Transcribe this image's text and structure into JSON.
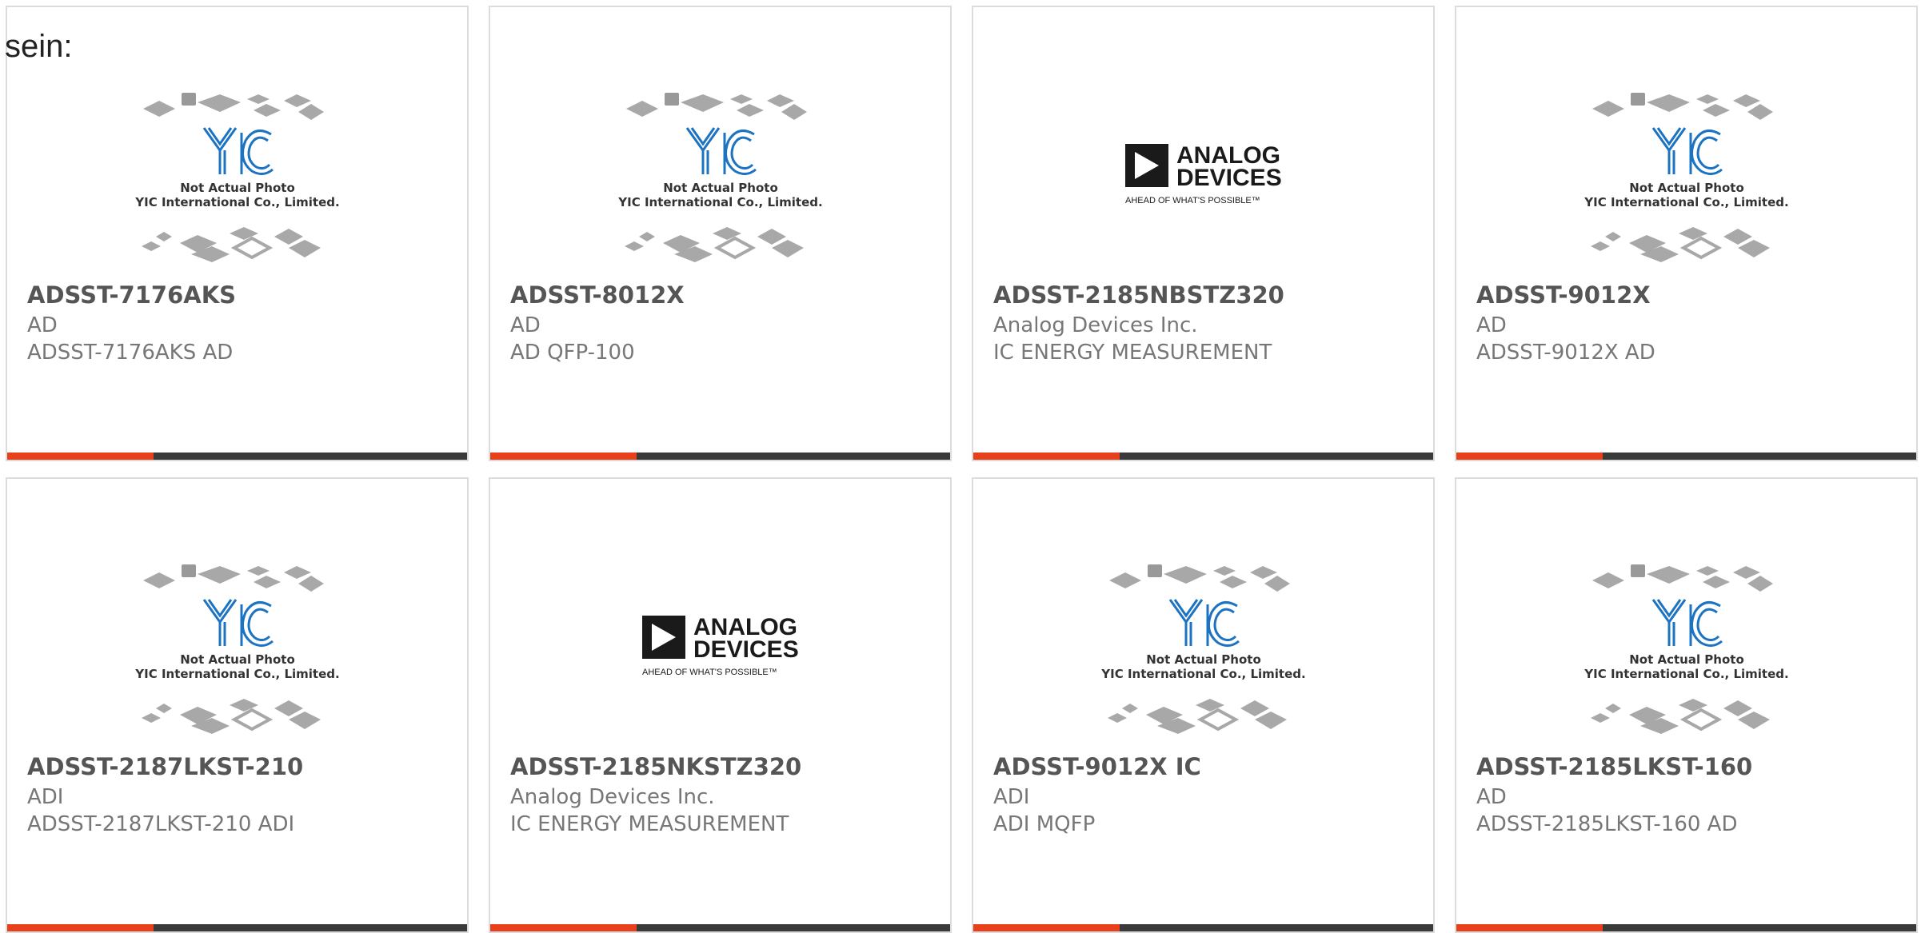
{
  "intro_text": "sein:",
  "colors": {
    "accent": "#e8401b",
    "bar": "#3a3a3a",
    "yic_blue": "#1b73c2"
  },
  "placeholder": {
    "caption_line1": "Not Actual Photo",
    "caption_line2": "YIC International Co., Limited.",
    "logo_text": "YIC"
  },
  "adi_logo": {
    "line1": "ANALOG",
    "line2": "DEVICES",
    "tagline": "AHEAD OF WHAT'S POSSIBLE™"
  },
  "products": [
    {
      "part_number": "ADSST-7176AKS",
      "manufacturer": "AD",
      "description": "ADSST-7176AKS AD",
      "image": "yic-placeholder"
    },
    {
      "part_number": "ADSST-8012X",
      "manufacturer": "AD",
      "description": "AD QFP-100",
      "image": "yic-placeholder"
    },
    {
      "part_number": "ADSST-2185NBSTZ320",
      "manufacturer": "Analog Devices Inc.",
      "description": "IC ENERGY MEASUREMENT",
      "image": "adi-logo"
    },
    {
      "part_number": "ADSST-9012X",
      "manufacturer": "AD",
      "description": "ADSST-9012X AD",
      "image": "yic-placeholder"
    },
    {
      "part_number": "ADSST-2187LKST-210",
      "manufacturer": "ADI",
      "description": "ADSST-2187LKST-210 ADI",
      "image": "yic-placeholder"
    },
    {
      "part_number": "ADSST-2185NKSTZ320",
      "manufacturer": "Analog Devices Inc.",
      "description": "IC ENERGY MEASUREMENT",
      "image": "adi-logo"
    },
    {
      "part_number": "ADSST-9012X IC",
      "manufacturer": "ADI",
      "description": "ADI MQFP",
      "image": "yic-placeholder"
    },
    {
      "part_number": "ADSST-2185LKST-160",
      "manufacturer": "AD",
      "description": "ADSST-2185LKST-160 AD",
      "image": "yic-placeholder"
    }
  ]
}
